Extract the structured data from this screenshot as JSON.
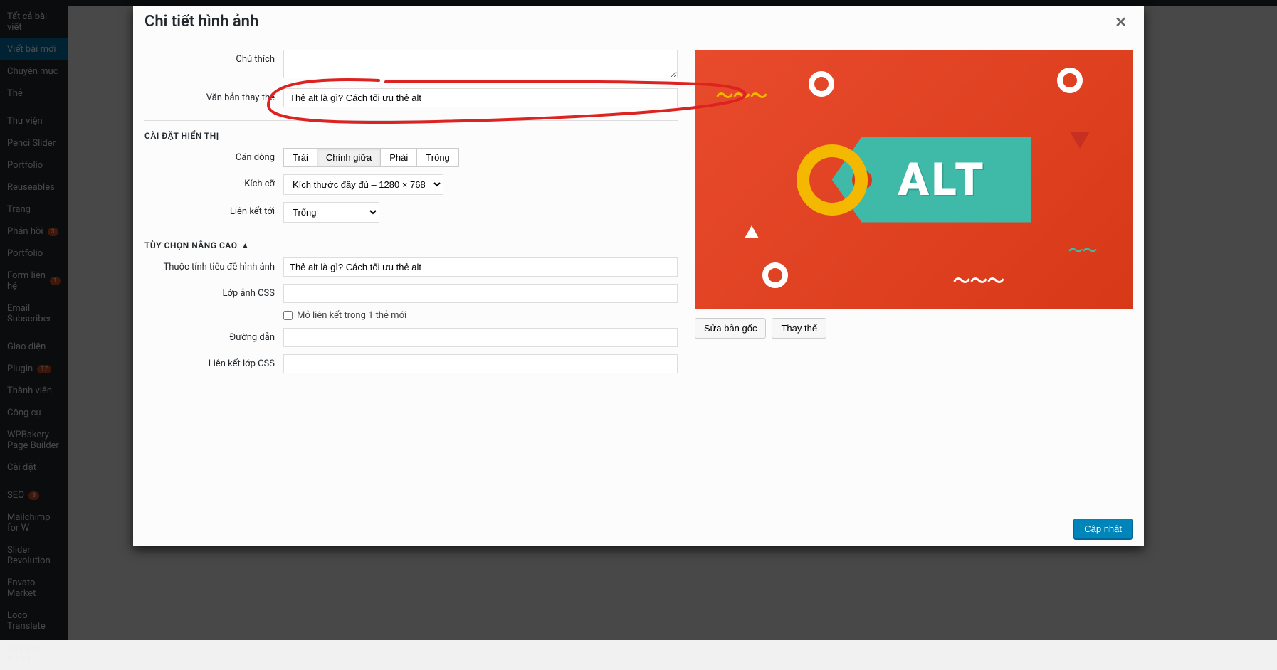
{
  "modal": {
    "title": "Chi tiết hình ảnh",
    "close": "✕",
    "caption_label": "Chú thích",
    "caption_value": "",
    "alt_label": "Văn bản thay thế",
    "alt_value": "Thẻ alt là gì? Cách tối ưu thẻ alt",
    "display_section": "CÀI ĐẶT HIỂN THỊ",
    "align_label": "Căn dòng",
    "align_options": {
      "left": "Trái",
      "center": "Chính giữa",
      "right": "Phải",
      "none": "Trống"
    },
    "size_label": "Kích cỡ",
    "size_value": "Kích thước đầy đủ – 1280 × 768",
    "linkto_label": "Liên kết tới",
    "linkto_value": "Trống",
    "advanced_section": "TÙY CHỌN NÂNG CAO",
    "title_attr_label": "Thuộc tính tiêu đề hình ảnh",
    "title_attr_value": "Thẻ alt là gì? Cách tối ưu thẻ alt",
    "css_class_label": "Lớp ảnh CSS",
    "css_class_value": "",
    "checkbox_label": "Mở liên kết trong 1 thẻ mới",
    "url_label": "Đường dẫn",
    "url_value": "",
    "link_css_label": "Liên kết lớp CSS",
    "link_css_value": "",
    "edit_original": "Sửa bản gốc",
    "replace": "Thay thế",
    "update": "Cập nhật",
    "preview_text": "ALT"
  },
  "sidebar": {
    "items": [
      "Tất cả bài viết",
      "Viết bài mới",
      "Chuyên mục",
      "Thẻ",
      "Thư viện",
      "Penci Slider",
      "Portfolio",
      "Reuseables",
      "Trang",
      "Phản hồi",
      "Portfolio",
      "Form liên hệ",
      "Email Subscriber",
      "Giao diện",
      "Plugin",
      "Thành viên",
      "Công cụ",
      "WPBakery Page Builder",
      "Cài đặt",
      "SEO",
      "Mailchimp for W",
      "Slider Revolution",
      "Envato Market",
      "Loco Translate",
      "Thu gọn menu"
    ],
    "badges": {
      "9": "3",
      "11": "1",
      "14": "17",
      "19": "3"
    }
  }
}
